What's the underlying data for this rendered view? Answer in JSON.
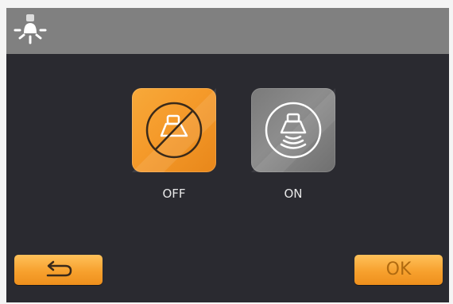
{
  "header": {
    "icon": "light-bulb-icon"
  },
  "options": [
    {
      "label": "OFF",
      "icon": "hood-light-off-icon",
      "selected": true
    },
    {
      "label": "ON",
      "icon": "hood-light-on-icon",
      "selected": false
    }
  ],
  "buttons": {
    "back_icon": "return-arrow-icon",
    "ok_label": "OK"
  },
  "colors": {
    "accent": "#f59a2a",
    "background": "#2a2a30",
    "titlebar": "#808080",
    "tile_inactive": "#808080"
  }
}
